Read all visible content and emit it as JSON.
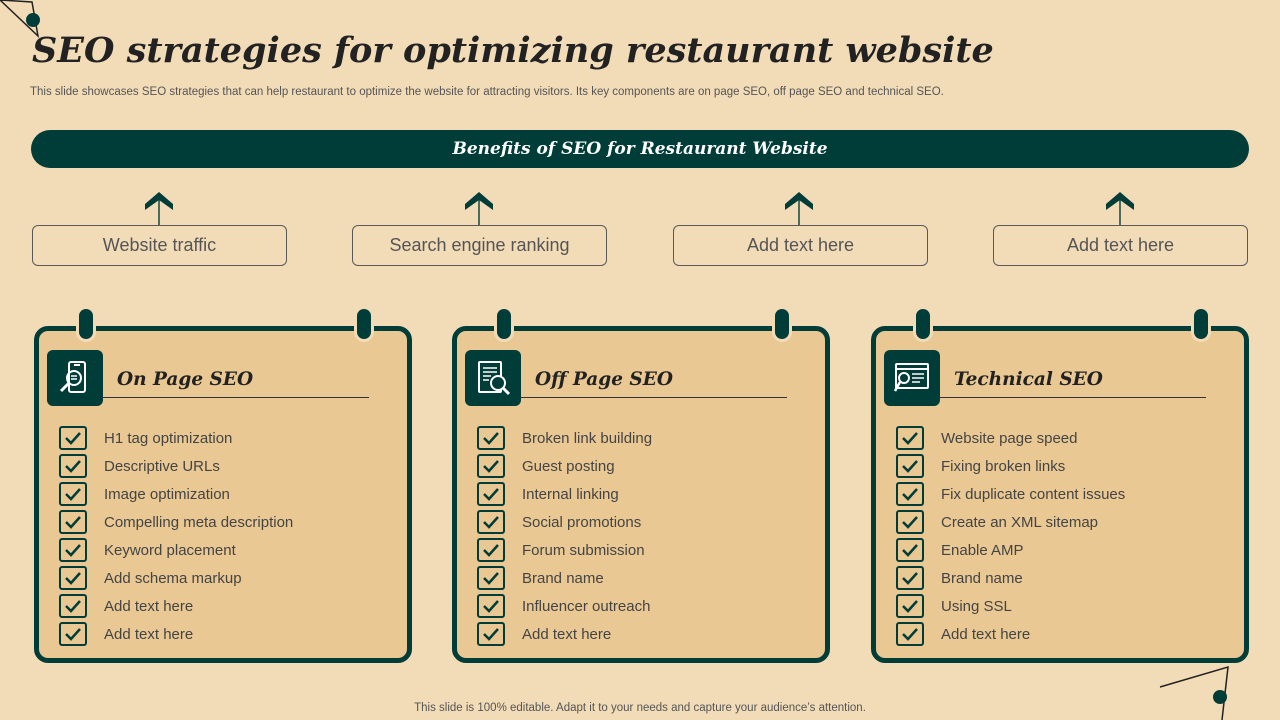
{
  "title": "SEO strategies for optimizing restaurant website",
  "subtitle": "This slide showcases SEO strategies that can help restaurant to optimize the website for attracting visitors. Its key components are on page SEO, off page SEO and technical SEO.",
  "banner": "Benefits of SEO for Restaurant Website",
  "benefits": [
    "Website traffic",
    "Search engine ranking",
    "Add text here",
    "Add text here"
  ],
  "cards": [
    {
      "icon": "mobile-search-icon",
      "title": "On Page SEO",
      "items": [
        "H1 tag optimization",
        "Descriptive URLs",
        "Image optimization",
        "Compelling meta description",
        "Keyword placement",
        "Add schema markup",
        "Add text here",
        "Add text here"
      ]
    },
    {
      "icon": "document-search-icon",
      "title": "Off Page SEO",
      "items": [
        "Broken link building",
        "Guest posting",
        "Internal linking",
        "Social promotions",
        "Forum submission",
        "Brand name",
        "Influencer outreach",
        "Add text here"
      ]
    },
    {
      "icon": "browser-seo-icon",
      "title": "Technical SEO",
      "items": [
        "Website page speed",
        "Fixing broken links",
        "Fix duplicate content issues",
        "Create an XML sitemap",
        "Enable AMP",
        "Brand name",
        "Using SSL",
        "Add text here"
      ]
    }
  ],
  "footer": "This slide is 100% editable. Adapt it to your needs and capture your audience’s attention.",
  "colors": {
    "accent": "#013d38",
    "background": "#f2dcb8",
    "card": "#e9c893"
  }
}
